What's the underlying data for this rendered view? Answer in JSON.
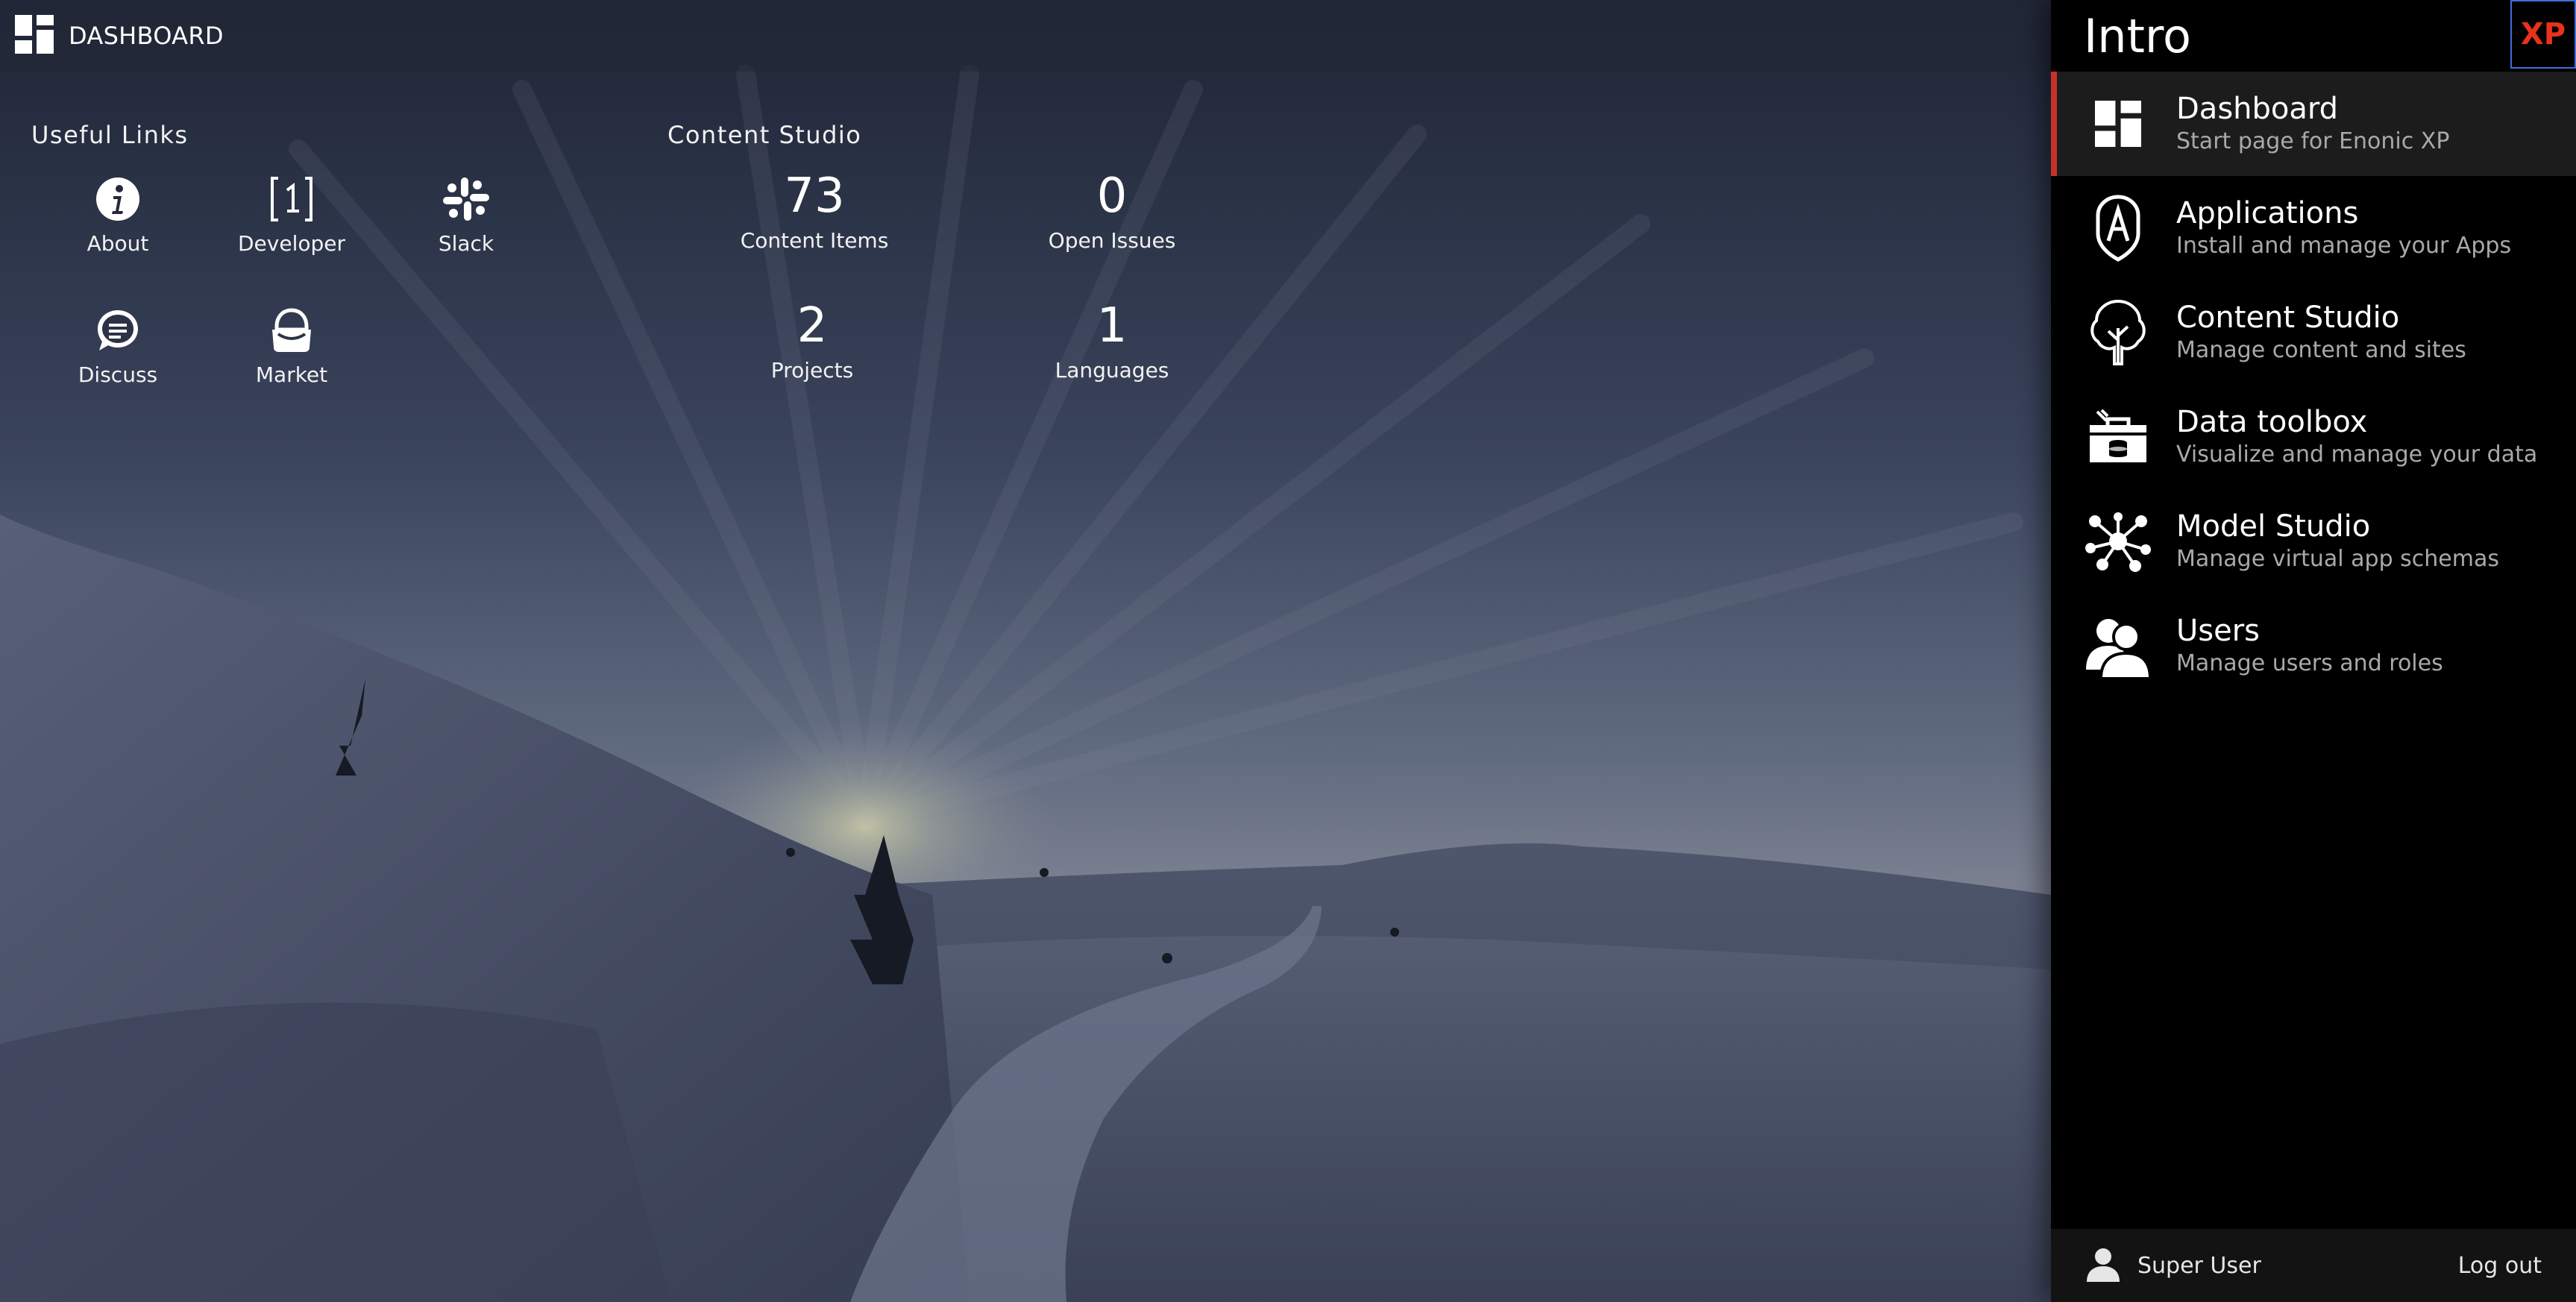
{
  "topbar": {
    "title": "DASHBOARD",
    "icon": "dashboard-icon"
  },
  "useful_links": {
    "title": "Useful Links",
    "items": [
      {
        "label": "About",
        "icon": "info-icon"
      },
      {
        "label": "Developer",
        "icon": "developer-icon"
      },
      {
        "label": "Slack",
        "icon": "slack-icon"
      },
      {
        "label": "Discuss",
        "icon": "discuss-icon"
      },
      {
        "label": "Market",
        "icon": "market-icon"
      }
    ]
  },
  "content_studio": {
    "title": "Content Studio",
    "stats": [
      {
        "value": "73",
        "label": "Content Items"
      },
      {
        "value": "0",
        "label": "Open Issues"
      },
      {
        "value": "2",
        "label": "Projects"
      },
      {
        "value": "1",
        "label": "Languages"
      }
    ]
  },
  "launcher": {
    "title": "Intro",
    "logo_text": "XP",
    "apps": [
      {
        "name": "Dashboard",
        "desc": "Start page for Enonic XP",
        "icon": "dashboard-icon",
        "active": true
      },
      {
        "name": "Applications",
        "desc": "Install and manage your Apps",
        "icon": "applications-icon"
      },
      {
        "name": "Content Studio",
        "desc": "Manage content and sites",
        "icon": "tree-icon"
      },
      {
        "name": "Data toolbox",
        "desc": "Visualize and manage your data",
        "icon": "toolbox-icon"
      },
      {
        "name": "Model Studio",
        "desc": "Manage virtual app schemas",
        "icon": "network-icon"
      },
      {
        "name": "Users",
        "desc": "Manage users and roles",
        "icon": "users-icon"
      }
    ],
    "footer": {
      "user": "Super User",
      "logout": "Log out"
    }
  },
  "colors": {
    "accent": "#c6322a",
    "logo": "#e8321c",
    "panel_bg": "#000000",
    "active_bg": "#1c1c1c"
  }
}
